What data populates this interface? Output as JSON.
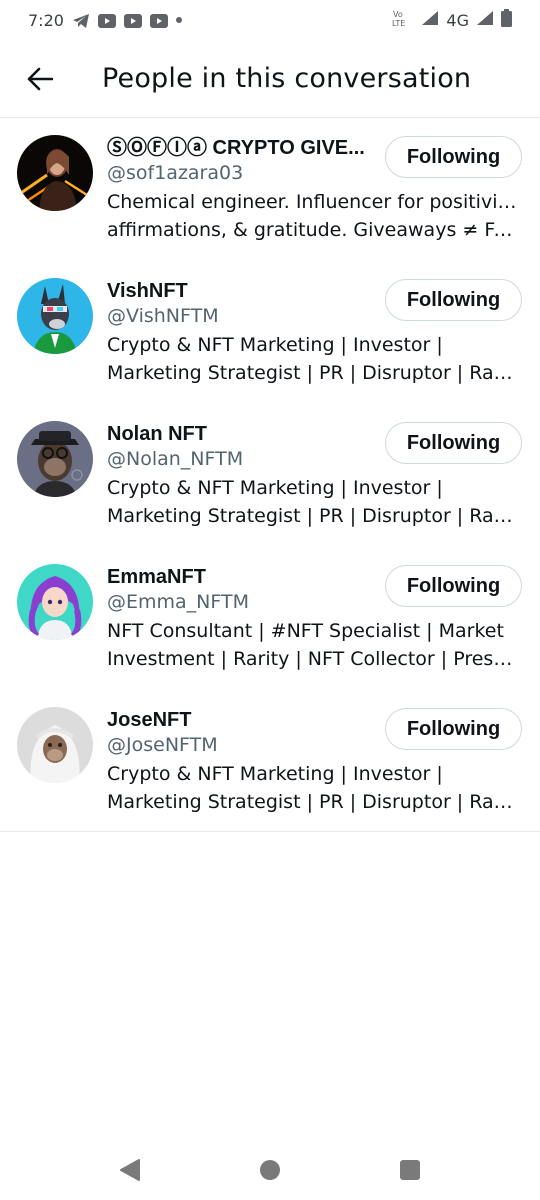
{
  "status_bar": {
    "time": "7:20",
    "network": "4G",
    "left_icons": [
      "telegram-icon",
      "youtube-icon",
      "youtube-icon",
      "youtube-icon",
      "dot-icon"
    ],
    "right_icons": [
      "volte-icon",
      "signal-icon",
      "signal-icon",
      "battery-icon"
    ]
  },
  "header": {
    "title": "People in this conversation",
    "back_icon": "arrow-left-icon"
  },
  "users": [
    {
      "name": "ⓈⓄⒻⒾⓐ CRYPTO GIVE...",
      "handle": "@sof1azara03",
      "bio_line1": "Chemical engineer. Influencer for positivity,",
      "bio_line2": "affirmations, & gratitude. Giveaways ≠ FA,...",
      "button": "Following"
    },
    {
      "name": "VishNFT",
      "handle": "@VishNFTM",
      "bio_line1": "Crypto & NFT Marketing | Investor |",
      "bio_line2": "Marketing Strategist | PR | Disruptor | Rarit...",
      "button": "Following"
    },
    {
      "name": "Nolan NFT",
      "handle": "@Nolan_NFTM",
      "bio_line1": "Crypto & NFT Marketing | Investor |",
      "bio_line2": "Marketing Strategist | PR | Disruptor | Rarit...",
      "button": "Following"
    },
    {
      "name": "EmmaNFT",
      "handle": "@Emma_NFTM",
      "bio_line1": "NFT Consultant | #NFT Specialist | Market",
      "bio_line2": "Investment | Rarity | NFT Collector | Press ...",
      "button": "Following"
    },
    {
      "name": "JoseNFT",
      "handle": "@JoseNFTM",
      "bio_line1": "Crypto & NFT Marketing | Investor |",
      "bio_line2": "Marketing Strategist | PR | Disruptor | Rarit...",
      "button": "Following"
    }
  ],
  "nav_bar": {
    "back": "triangle-back-icon",
    "home": "circle-home-icon",
    "recents": "square-recents-icon"
  },
  "colors": {
    "text_primary": "#0f1419",
    "text_secondary": "#536471",
    "border": "#cfd9de",
    "divider": "#e6e9ec"
  }
}
